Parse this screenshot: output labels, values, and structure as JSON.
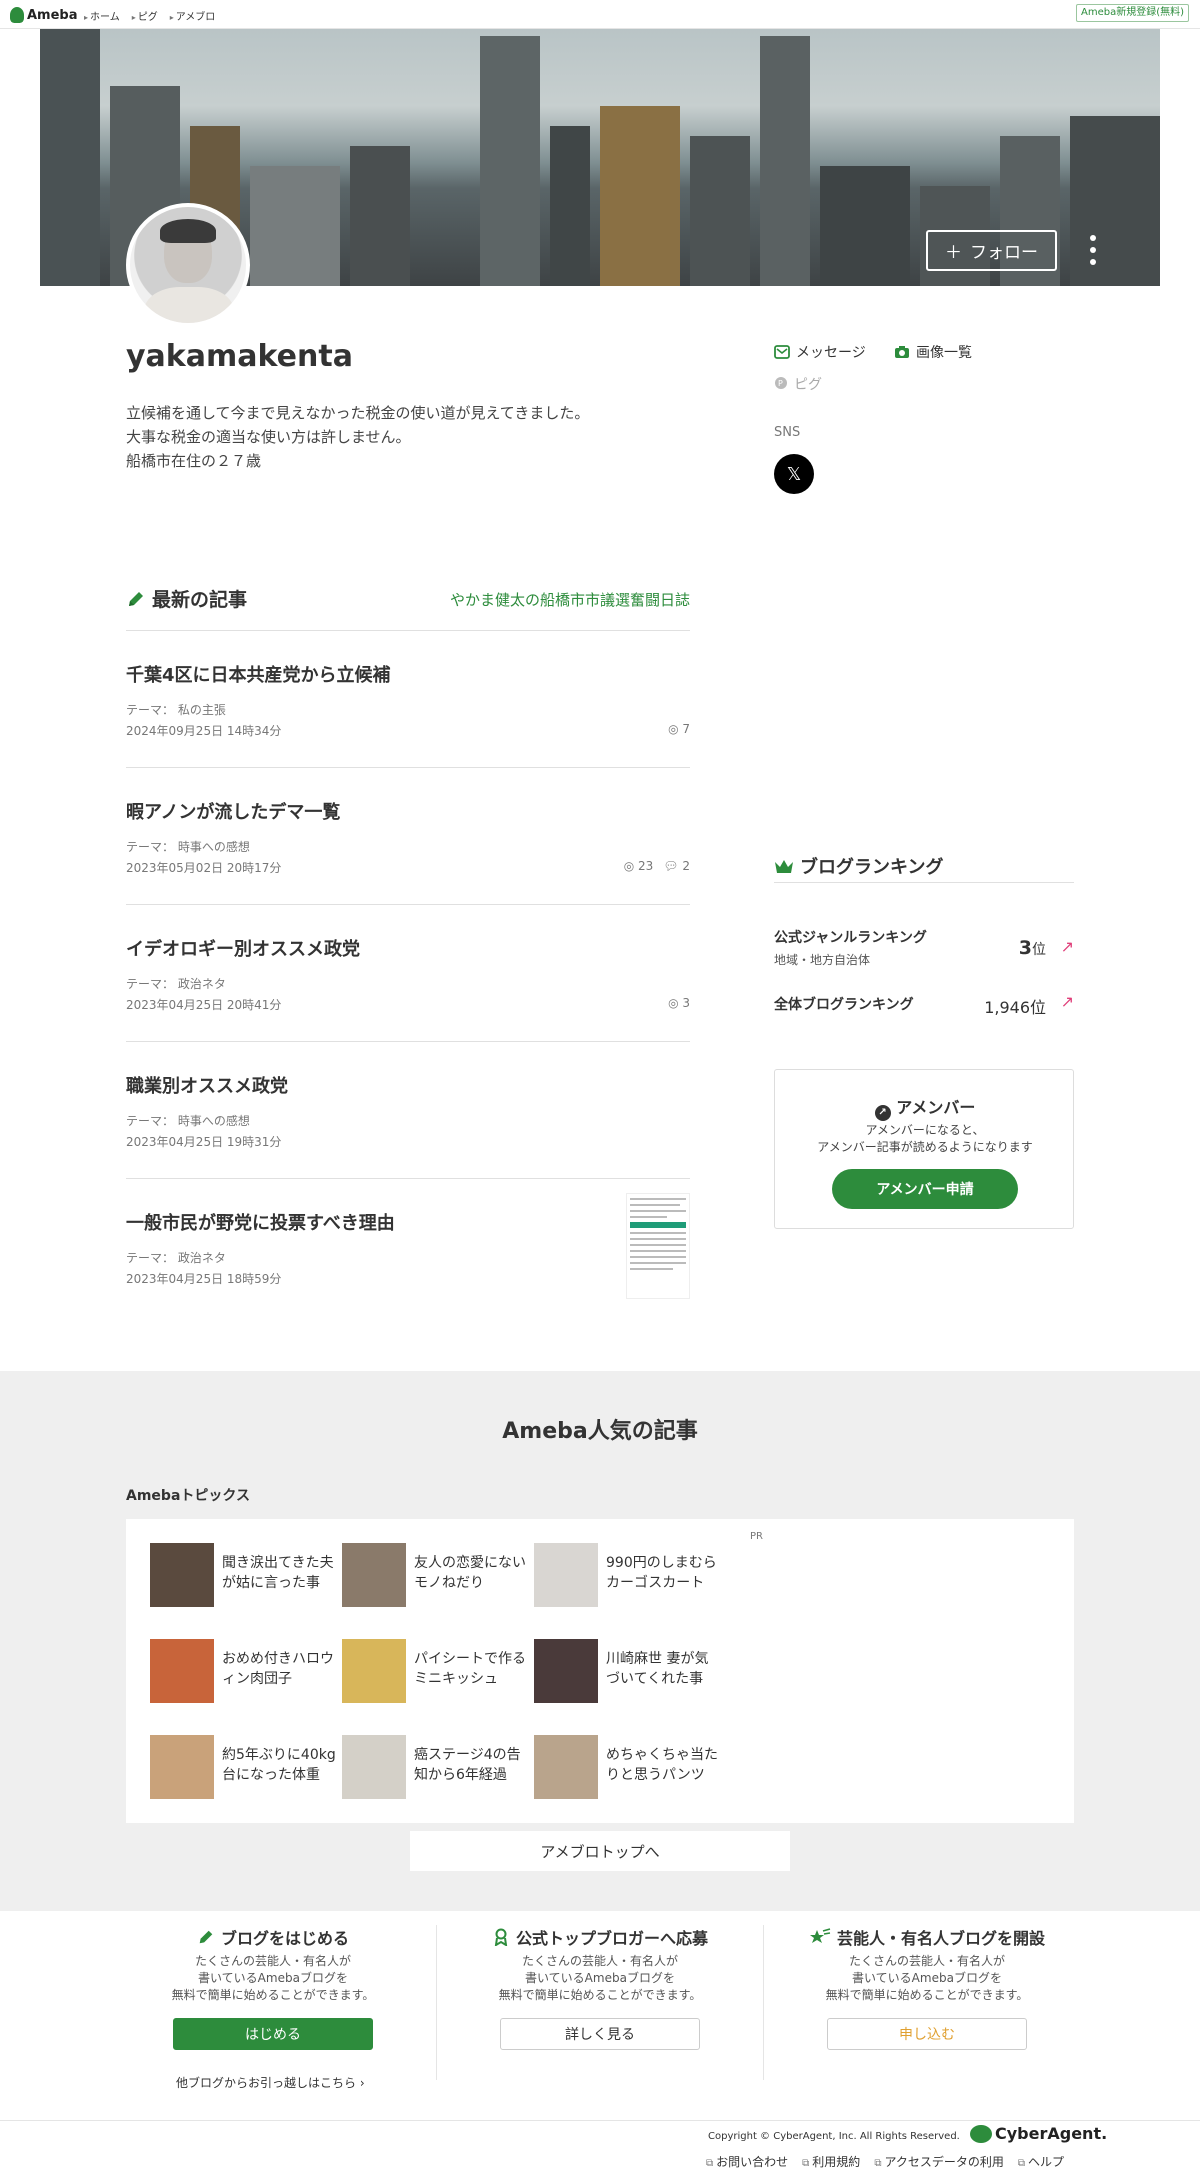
{
  "header": {
    "logo_text": "Ameba",
    "breadcrumbs": [
      "ホーム",
      "ピグ",
      "アメブロ"
    ],
    "signup_label": "Ameba新規登録(無料)"
  },
  "banner": {
    "follow_label": "フォロー"
  },
  "profile": {
    "blog_name": "yakamakenta",
    "description": [
      "立候補を通して今まで見えなかった税金の使い道が見えてきました。",
      "大事な税金の適当な使い方は許しません。",
      "船橋市在住の２７歳"
    ],
    "links": {
      "message": "メッセージ",
      "images": "画像一覧",
      "pigg": "ピグ"
    },
    "sns_label": "SNS",
    "x_icon": "𝕏"
  },
  "latest": {
    "title": "最新の記事",
    "blog_title_link": "やかま健太の船橋市市議選奮闘日誌",
    "articles": [
      {
        "title": "千葉4区に日本共産党から立候補",
        "theme": "テーマ： 私の主張",
        "date": "2024年09月25日 14時34分",
        "views": "7",
        "comments": ""
      },
      {
        "title": "暇アノンが流したデマ一覧",
        "theme": "テーマ： 時事への感想",
        "date": "2023年05月02日 20時17分",
        "views": "23",
        "comments": "2"
      },
      {
        "title": "イデオロギー別オススメ政党",
        "theme": "テーマ： 政治ネタ",
        "date": "2023年04月25日 20時41分",
        "views": "3",
        "comments": ""
      },
      {
        "title": "職業別オススメ政党",
        "theme": "テーマ： 時事への感想",
        "date": "2023年04月25日 19時31分",
        "views": "",
        "comments": ""
      },
      {
        "title": "一般市民が野党に投票すべき理由",
        "theme": "テーマ： 政治ネタ",
        "date": "2023年04月25日 18時59分",
        "views": "",
        "comments": ""
      }
    ]
  },
  "ranking": {
    "title": "ブログランキング",
    "genre_label": "公式ジャンルランキング",
    "genre_sub": "地域・地方自治体",
    "genre_rank_num": "3",
    "genre_rank_unit": "位",
    "overall_label": "全体ブログランキング",
    "overall_rank": "1,946位"
  },
  "amember": {
    "title": "アメンバー",
    "text_line1": "アメンバーになると、",
    "text_line2": "アメンバー記事が読めるようになります",
    "button": "アメンバー申請"
  },
  "popular": {
    "title": "Ameba人気の記事",
    "topics_label": "Amebaトピックス",
    "pr_label": "PR",
    "topics": [
      {
        "text": "聞き涙出てきた夫が姑に言った事",
        "color": "#5a4a3e"
      },
      {
        "text": "友人の恋愛にないモノねだり",
        "color": "#8a7a6a"
      },
      {
        "text": "990円のしまむらカーゴスカート",
        "color": "#d9d6d2"
      },
      {
        "text": "おめめ付きハロウィン肉団子",
        "color": "#c8643a"
      },
      {
        "text": "パイシートで作るミニキッシュ",
        "color": "#d8b65a"
      },
      {
        "text": "川崎麻世 妻が気づいてくれた事",
        "color": "#4a3a3a"
      },
      {
        "text": "約5年ぶりに40kg台になった体重",
        "color": "#c9a27a"
      },
      {
        "text": "癌ステージ4の告知から6年経過",
        "color": "#d4d0c8"
      },
      {
        "text": "めちゃくちゃ当たりと思うパンツ",
        "color": "#b9a48c"
      }
    ],
    "top_button": "アメブロトップへ"
  },
  "start": {
    "blocks": [
      {
        "title": "ブログをはじめる",
        "desc1": "たくさんの芸能人・有名人が",
        "desc2": "書いているAmebaブログを",
        "desc3": "無料で簡単に始めることができます。",
        "button": "はじめる"
      },
      {
        "title": "公式トップブロガーへ応募",
        "desc1": "たくさんの芸能人・有名人が",
        "desc2": "書いているAmebaブログを",
        "desc3": "無料で簡単に始めることができます。",
        "button": "詳しく見る"
      },
      {
        "title": "芸能人・有名人ブログを開設",
        "desc1": "たくさんの芸能人・有名人が",
        "desc2": "書いているAmebaブログを",
        "desc3": "無料で簡単に始めることができます。",
        "button": "申し込む"
      }
    ],
    "migrate_link": "他ブログからお引っ越しはこちら ›"
  },
  "footer": {
    "copyright": "Copyright © CyberAgent, Inc. All Rights Reserved.",
    "ca_logo": "CyberAgent.",
    "links": [
      "お問い合わせ",
      "利用規約",
      "アクセスデータの利用",
      "ヘルプ"
    ]
  },
  "colors": {
    "accent": "#2d8c3c",
    "rank_arrow": "#e0407a",
    "apply_button_text": "#e0a030"
  }
}
